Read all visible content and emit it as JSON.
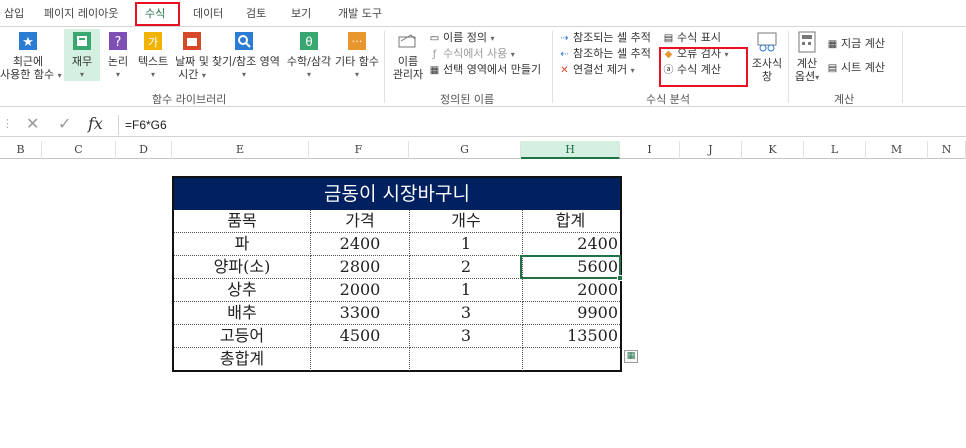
{
  "tabs": [
    "삽입",
    "페이지 레이아웃",
    "수식",
    "데이터",
    "검토",
    "보기",
    "개발 도구"
  ],
  "active_tab": "수식",
  "ribbon": {
    "function_library": {
      "recent_line1": "최근에",
      "recent_line2": "사용한 함수",
      "financial": "재무",
      "logical": "논리",
      "text": "텍스트",
      "datetime_line1": "날짜 및",
      "datetime_line2": "시간",
      "lookup": "찾기/참조 영역",
      "math": "수학/삼각",
      "more": "기타 함수",
      "group_label": "함수 라이브러리"
    },
    "defined_names": {
      "manager_line1": "이름",
      "manager_line2": "관리자",
      "define": "이름 정의",
      "use_in_formula": "수식에서 사용",
      "create_from_selection": "선택 영역에서 만들기",
      "group_label": "정의된 이름"
    },
    "formula_auditing": {
      "trace_precedents": "참조되는 셀 추적",
      "trace_dependents": "참조하는 셀 추적",
      "remove_arrows": "연결선 제거",
      "show_formulas": "수식 표시",
      "error_checking": "오류 검사",
      "evaluate_formula": "수식 계산",
      "watch_line1": "조사식",
      "watch_line2": "창",
      "group_label": "수식 분석"
    },
    "calculation": {
      "options_line1": "계산",
      "options_line2": "옵션",
      "calc_now": "지금 계산",
      "calc_sheet": "시트 계산",
      "group_label": "계산"
    }
  },
  "formula_bar": {
    "fx": "fx",
    "formula": "=F6*G6"
  },
  "columns": [
    "B",
    "C",
    "D",
    "E",
    "F",
    "G",
    "H",
    "I",
    "J",
    "K",
    "L",
    "M",
    "N"
  ],
  "selected_column": "H",
  "table": {
    "title": "금동이 시장바구니",
    "headers": [
      "품목",
      "가격",
      "개수",
      "합계"
    ],
    "rows": [
      [
        "파",
        "2400",
        "1",
        "2400"
      ],
      [
        "양파(소)",
        "2800",
        "2",
        "5600"
      ],
      [
        "상추",
        "2000",
        "1",
        "2000"
      ],
      [
        "배추",
        "3300",
        "3",
        "9900"
      ],
      [
        "고등어",
        "4500",
        "3",
        "13500"
      ],
      [
        "총합계",
        "",
        "",
        ""
      ]
    ]
  },
  "colors": {
    "title_bg": "#002060",
    "accent": "#217346",
    "highlight": "#e81123"
  }
}
